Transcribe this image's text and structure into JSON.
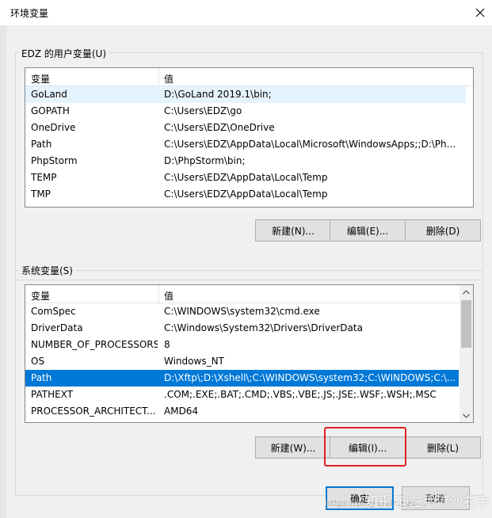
{
  "window": {
    "title": "环境变量"
  },
  "user_group": {
    "label": "EDZ 的用户变量(U)",
    "headers": {
      "var": "变量",
      "val": "值"
    },
    "rows": [
      {
        "name": "GoLand",
        "value": "D:\\GoLand 2019.1\\bin;"
      },
      {
        "name": "GOPATH",
        "value": "C:\\Users\\EDZ\\go"
      },
      {
        "name": "OneDrive",
        "value": "C:\\Users\\EDZ\\OneDrive"
      },
      {
        "name": "Path",
        "value": "C:\\Users\\EDZ\\AppData\\Local\\Microsoft\\WindowsApps;;D:\\Ph..."
      },
      {
        "name": "PhpStorm",
        "value": "D:\\PhpStorm\\bin;"
      },
      {
        "name": "TEMP",
        "value": "C:\\Users\\EDZ\\AppData\\Local\\Temp"
      },
      {
        "name": "TMP",
        "value": "C:\\Users\\EDZ\\AppData\\Local\\Temp"
      }
    ],
    "buttons": {
      "new": "新建(N)...",
      "edit": "编辑(E)...",
      "delete": "删除(D)"
    }
  },
  "system_group": {
    "label": "系统变量(S)",
    "headers": {
      "var": "变量",
      "val": "值"
    },
    "rows": [
      {
        "name": "ComSpec",
        "value": "C:\\WINDOWS\\system32\\cmd.exe"
      },
      {
        "name": "DriverData",
        "value": "C:\\Windows\\System32\\Drivers\\DriverData"
      },
      {
        "name": "NUMBER_OF_PROCESSORS",
        "value": "8"
      },
      {
        "name": "OS",
        "value": "Windows_NT"
      },
      {
        "name": "Path",
        "value": "D:\\Xftp\\;D:\\Xshell\\;C:\\WINDOWS\\system32;C:\\WINDOWS;C:\\..."
      },
      {
        "name": "PATHEXT",
        "value": ".COM;.EXE;.BAT;.CMD;.VBS;.VBE;.JS;.JSE;.WSF;.WSH;.MSC"
      },
      {
        "name": "PROCESSOR_ARCHITECT...",
        "value": "AMD64"
      }
    ],
    "buttons": {
      "new": "新建(W)...",
      "edit": "编辑(I)...",
      "delete": "删除(L)"
    }
  },
  "footer": {
    "ok": "确定",
    "cancel": "取消"
  },
  "watermark": {
    "main": "知乎 @左手流沙右手",
    "faint": "https://blog.csdn.net/..."
  },
  "colors": {
    "selection": "#0078d7",
    "highlight_box": "#e02020",
    "hover": "#e5f3ff"
  }
}
